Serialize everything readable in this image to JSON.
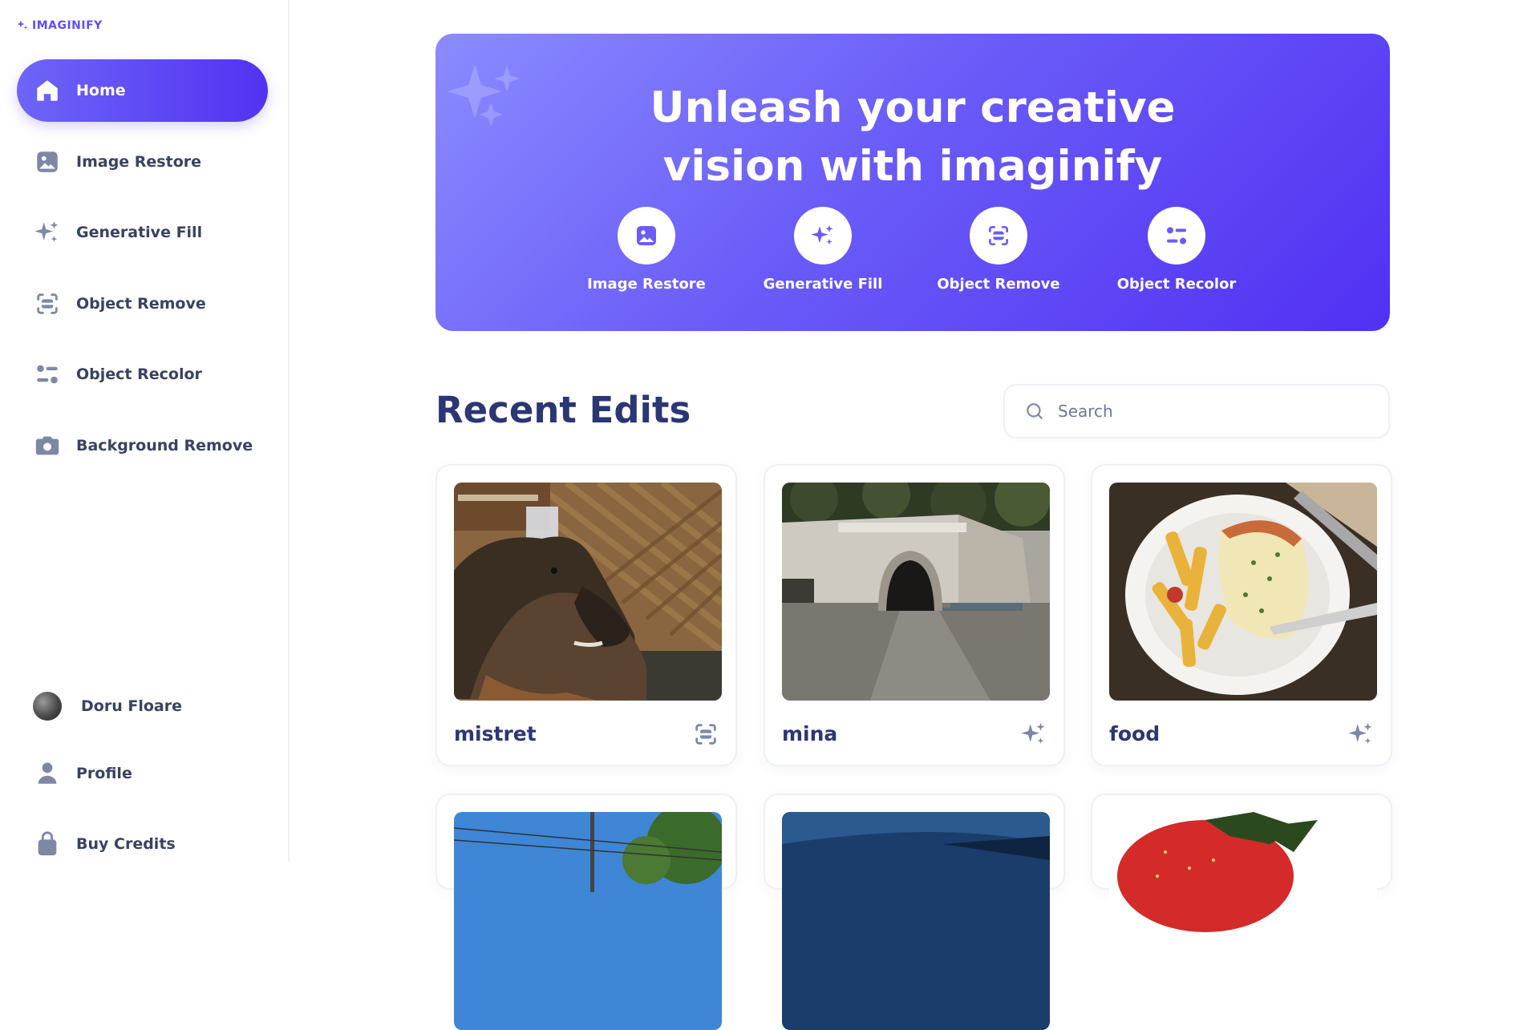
{
  "app": {
    "logo_text": "IMAGINIFY"
  },
  "sidebar": {
    "items": [
      {
        "label": "Home",
        "icon": "home-icon",
        "active": true
      },
      {
        "label": "Image Restore",
        "icon": "image-icon"
      },
      {
        "label": "Generative Fill",
        "icon": "sparkles-icon"
      },
      {
        "label": "Object Remove",
        "icon": "scan-icon"
      },
      {
        "label": "Object Recolor",
        "icon": "filter-icon"
      },
      {
        "label": "Background Remove",
        "icon": "camera-icon"
      }
    ],
    "user": {
      "name": "Doru Floare"
    },
    "bottom_items": [
      {
        "label": "Profile",
        "icon": "user-icon"
      },
      {
        "label": "Buy Credits",
        "icon": "bag-icon"
      }
    ]
  },
  "hero": {
    "title_line1": "Unleash your creative",
    "title_line2": "vision with imaginify",
    "tools": [
      {
        "label": "Image Restore",
        "icon": "image-icon"
      },
      {
        "label": "Generative Fill",
        "icon": "sparkles-icon"
      },
      {
        "label": "Object Remove",
        "icon": "scan-icon"
      },
      {
        "label": "Object Recolor",
        "icon": "filter-icon"
      }
    ]
  },
  "recent": {
    "title": "Recent Edits",
    "search_placeholder": "Search",
    "cards": [
      {
        "name": "mistret",
        "type_icon": "scan-icon"
      },
      {
        "name": "mina",
        "type_icon": "sparkles-icon"
      },
      {
        "name": "food",
        "type_icon": "sparkles-icon"
      }
    ]
  },
  "colors": {
    "accent": "#624cf5",
    "hero_start": "#8b8bff",
    "hero_end": "#5130f3",
    "text_dark": "#2b3674",
    "icon_gray": "#7d88a7"
  }
}
